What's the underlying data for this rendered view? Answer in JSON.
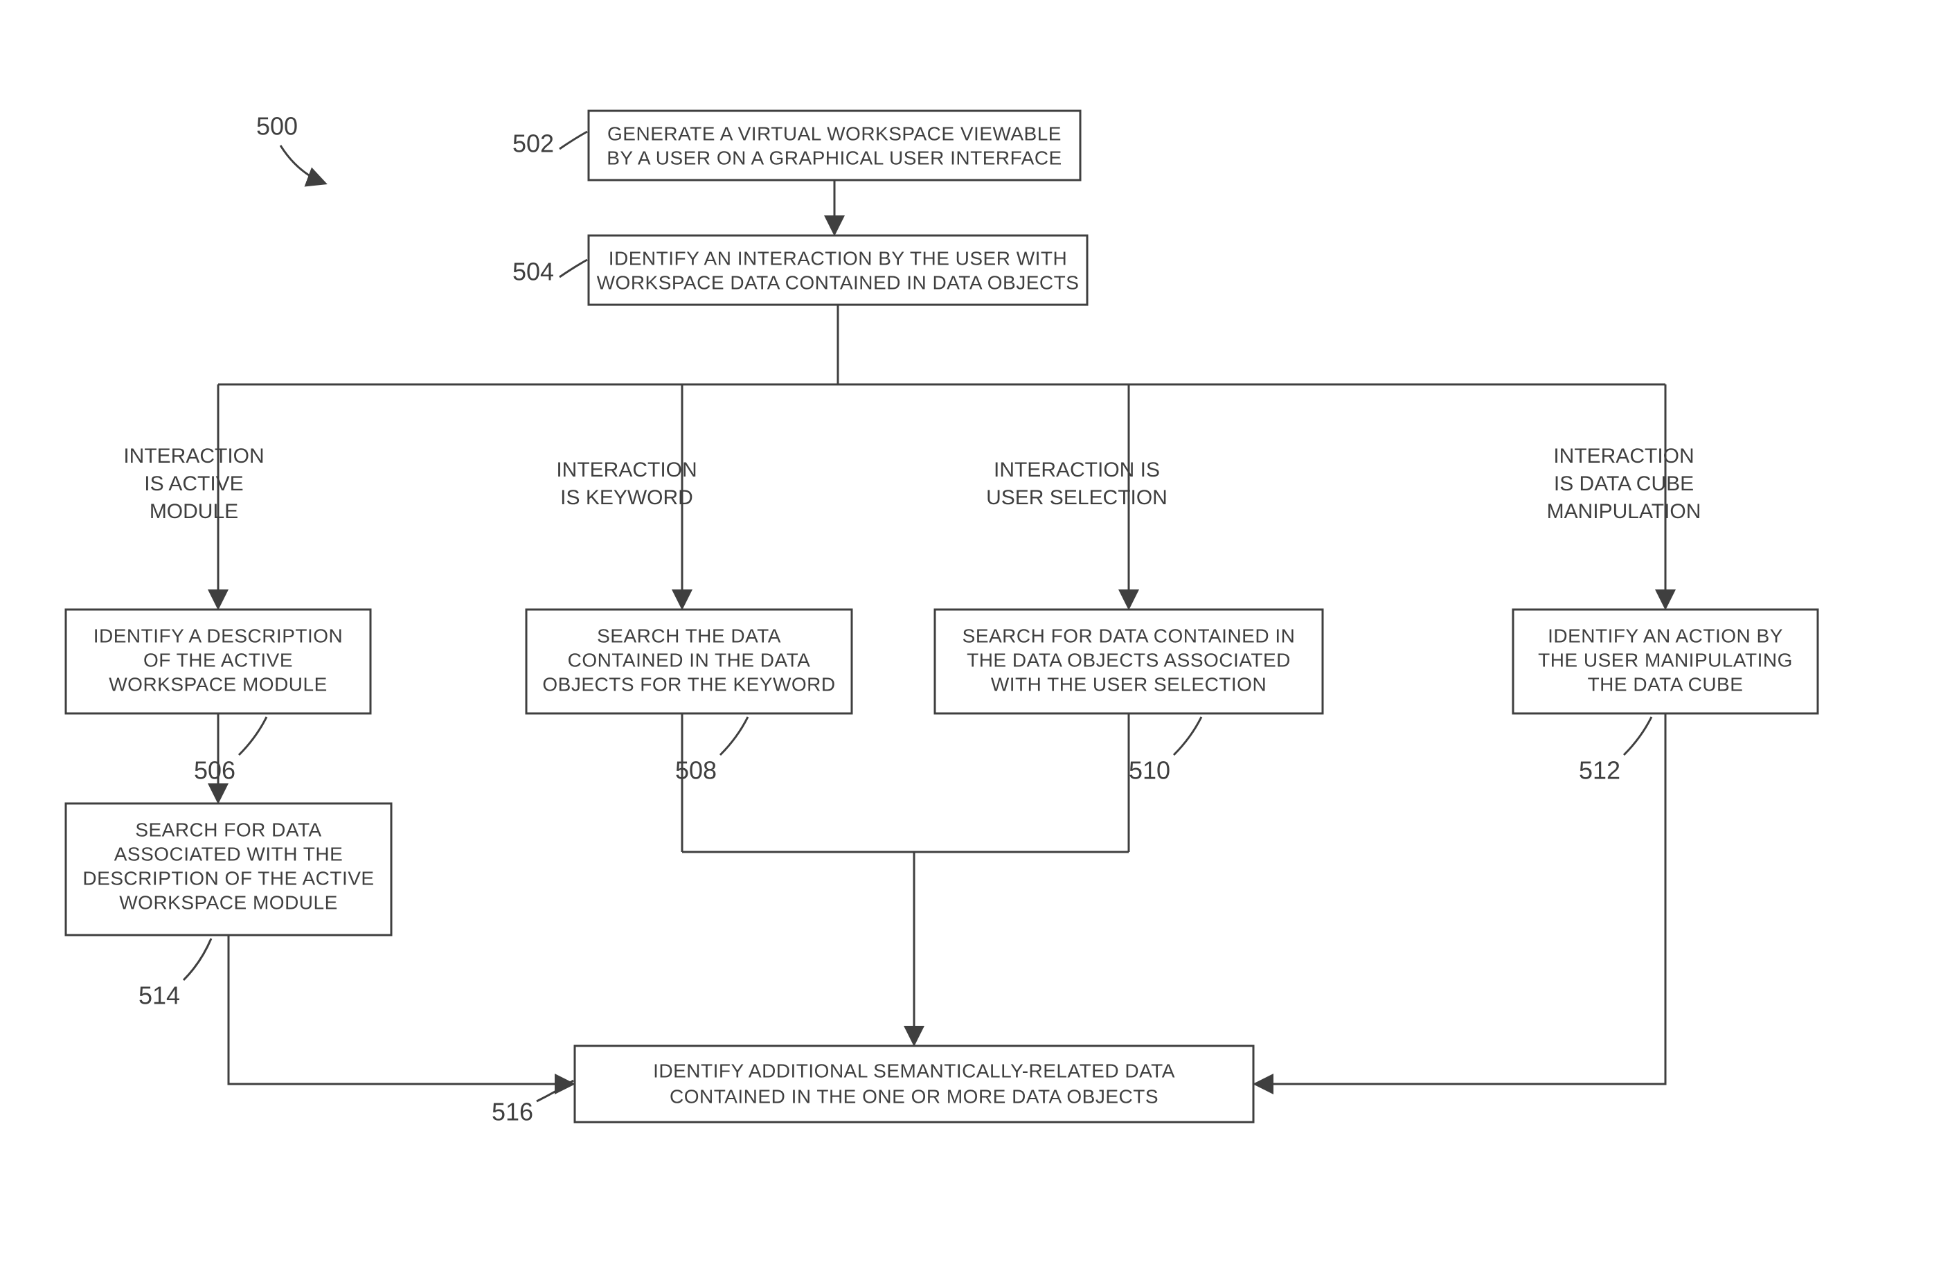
{
  "figure_number": "500",
  "boxes": {
    "b502": {
      "num": "502",
      "lines": [
        "GENERATE A VIRTUAL WORKSPACE VIEWABLE",
        "BY A USER ON A GRAPHICAL USER INTERFACE"
      ]
    },
    "b504": {
      "num": "504",
      "lines": [
        "IDENTIFY AN INTERACTION BY THE USER WITH",
        "WORKSPACE DATA CONTAINED IN DATA OBJECTS"
      ]
    },
    "b506": {
      "num": "506",
      "lines": [
        "IDENTIFY A DESCRIPTION",
        "OF THE ACTIVE",
        "WORKSPACE MODULE"
      ]
    },
    "b508": {
      "num": "508",
      "lines": [
        "SEARCH THE DATA",
        "CONTAINED IN THE DATA",
        "OBJECTS FOR THE KEYWORD"
      ]
    },
    "b510": {
      "num": "510",
      "lines": [
        "SEARCH FOR DATA CONTAINED IN",
        "THE DATA OBJECTS ASSOCIATED",
        "WITH THE USER SELECTION"
      ]
    },
    "b512": {
      "num": "512",
      "lines": [
        "IDENTIFY AN ACTION BY",
        "THE USER MANIPULATING",
        "THE DATA CUBE"
      ]
    },
    "b514": {
      "num": "514",
      "lines": [
        "SEARCH FOR DATA",
        "ASSOCIATED WITH THE",
        "DESCRIPTION OF THE ACTIVE",
        "WORKSPACE MODULE"
      ]
    },
    "b516": {
      "num": "516",
      "lines": [
        "IDENTIFY ADDITIONAL SEMANTICALLY-RELATED DATA",
        "CONTAINED IN THE ONE OR MORE DATA OBJECTS"
      ]
    }
  },
  "branch_labels": {
    "active": [
      "INTERACTION",
      "IS ACTIVE",
      "MODULE"
    ],
    "keyword": [
      "INTERACTION",
      "IS KEYWORD"
    ],
    "selection": [
      "INTERACTION IS",
      "USER SELECTION"
    ],
    "cube": [
      "INTERACTION",
      "IS DATA CUBE",
      "MANIPULATION"
    ]
  }
}
